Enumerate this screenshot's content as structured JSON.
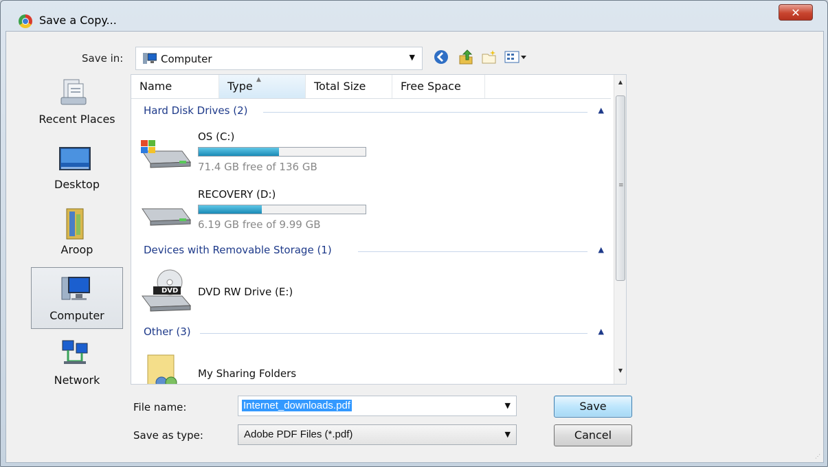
{
  "window": {
    "title": "Save a Copy...",
    "close_glyph": "✕"
  },
  "toolbar": {
    "save_in_label": "Save in:",
    "save_in_value": "Computer",
    "icons": [
      "back-icon",
      "up-folder-icon",
      "new-folder-icon",
      "views-menu-icon"
    ]
  },
  "places": [
    {
      "label": "Recent Places",
      "icon": "recent-places-icon",
      "selected": false
    },
    {
      "label": "Desktop",
      "icon": "desktop-icon",
      "selected": false
    },
    {
      "label": "Aroop",
      "icon": "user-folder-icon",
      "selected": false
    },
    {
      "label": "Computer",
      "icon": "computer-icon",
      "selected": true
    },
    {
      "label": "Network",
      "icon": "network-icon",
      "selected": false
    }
  ],
  "columns": [
    "Name",
    "Type",
    "Total Size",
    "Free Space"
  ],
  "groups": [
    {
      "label": "Hard Disk Drives (2)"
    },
    {
      "label": "Devices with Removable Storage (1)"
    },
    {
      "label": "Other (3)"
    }
  ],
  "drives": [
    {
      "name": "OS (C:)",
      "free_text": "71.4 GB free of 136 GB",
      "used_fraction": 0.48
    },
    {
      "name": "RECOVERY (D:)",
      "free_text": "6.19 GB free of 9.99 GB",
      "used_fraction": 0.38
    }
  ],
  "dvd": {
    "name": "DVD RW Drive (E:)",
    "badge": "DVD"
  },
  "other_items": [
    {
      "name": "My Sharing Folders"
    }
  ],
  "form": {
    "file_name_label": "File name:",
    "file_name_value": "Internet_downloads.pdf",
    "save_as_type_label": "Save as type:",
    "save_as_type_value": "Adobe PDF Files (*.pdf)"
  },
  "buttons": {
    "save": "Save",
    "cancel": "Cancel"
  },
  "colors": {
    "selection": "#3399ff",
    "group_header": "#1e3a8a",
    "close_button": "#c8452f"
  }
}
